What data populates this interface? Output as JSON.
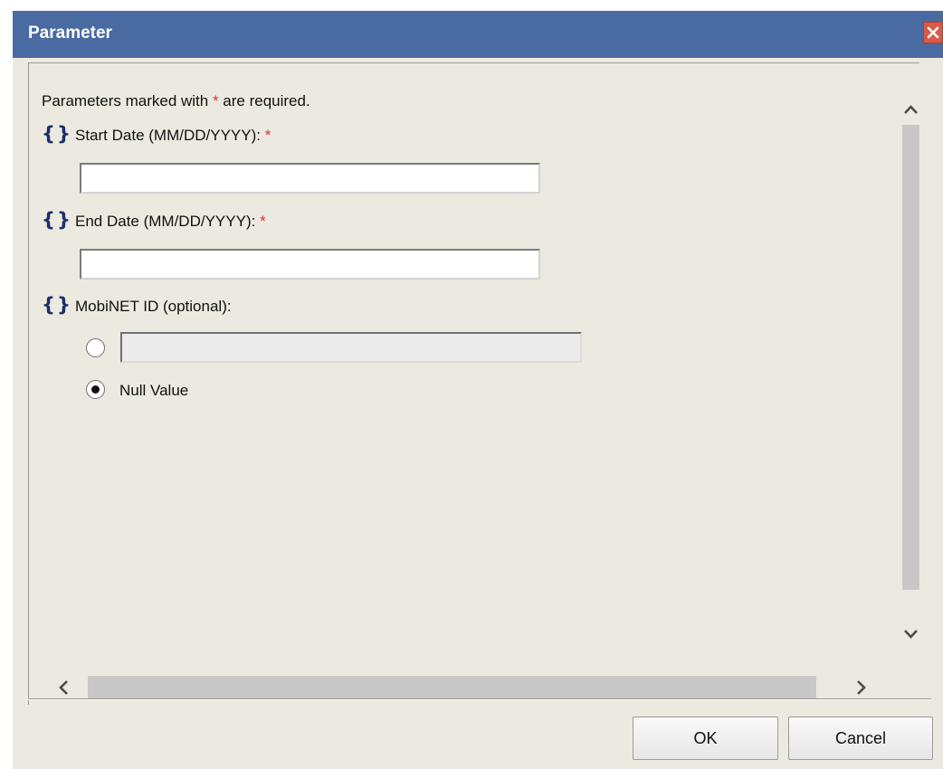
{
  "window": {
    "title": "Parameter",
    "titlebar_color": "#4a6ba1",
    "close_icon": "close-icon"
  },
  "form": {
    "required_note_prefix": "Parameters marked with ",
    "required_marker": "*",
    "required_note_suffix": " are required.",
    "required_color": "#e03030",
    "parameter_icon": "braces-icon",
    "parameter_icon_glyph": "{}",
    "fields": [
      {
        "label": "Start Date (MM/DD/YYYY):",
        "required_marker": "*",
        "value": ""
      },
      {
        "label": "End Date (MM/DD/YYYY):",
        "required_marker": "*",
        "value": ""
      },
      {
        "label": "MobiNET ID (optional):",
        "value": ""
      }
    ],
    "mobinet": {
      "value_option_selected": false,
      "null_option_label": "Null Value",
      "null_option_selected": true
    }
  },
  "buttons": {
    "ok_label": "OK",
    "cancel_label": "Cancel"
  }
}
